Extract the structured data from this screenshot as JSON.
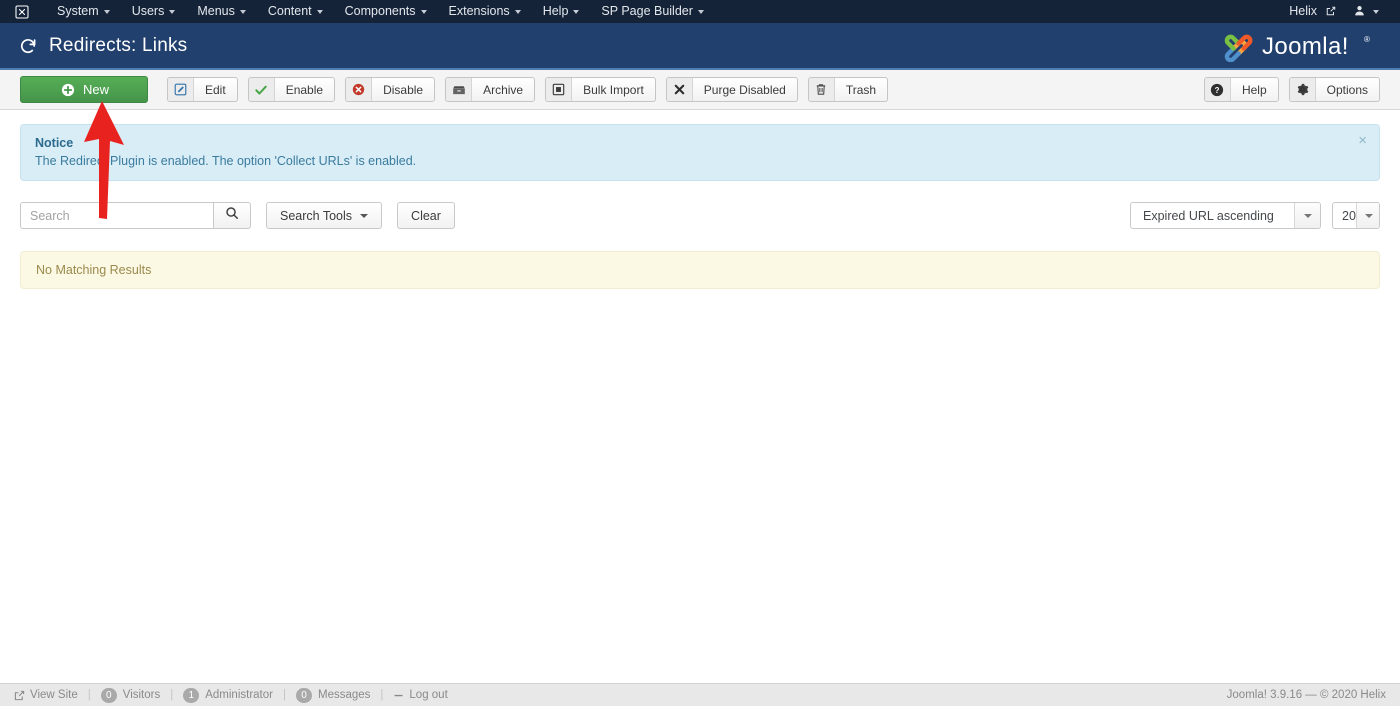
{
  "topnav": {
    "brand_icon": "joomla-mark-icon",
    "items": [
      {
        "label": "System",
        "has_caret": true
      },
      {
        "label": "Users",
        "has_caret": true
      },
      {
        "label": "Menus",
        "has_caret": true
      },
      {
        "label": "Content",
        "has_caret": true
      },
      {
        "label": "Components",
        "has_caret": true
      },
      {
        "label": "Extensions",
        "has_caret": true
      },
      {
        "label": "Help",
        "has_caret": true
      },
      {
        "label": "SP Page Builder",
        "has_caret": true
      }
    ],
    "site_link": "Helix",
    "site_link_icon": "external-link-icon",
    "user_icon": "user-icon"
  },
  "header": {
    "title": "Redirects: Links",
    "title_icon": "redirect-arrow-icon",
    "logo_text": "Joomla!",
    "logo_icon": "joomla-logo-icon",
    "bg_color": "#21406e",
    "accent_color": "#4d7db3"
  },
  "toolbar": {
    "new_label": "New",
    "new_icon": "plus-circle-icon",
    "new_color": "#48a14c",
    "buttons": [
      {
        "label": "Edit",
        "icon": "pencil-square-icon"
      },
      {
        "label": "Enable",
        "icon": "check-icon"
      },
      {
        "label": "Disable",
        "icon": "times-circle-icon"
      },
      {
        "label": "Archive",
        "icon": "archive-box-icon"
      },
      {
        "label": "Bulk Import",
        "icon": "import-square-icon"
      },
      {
        "label": "Purge Disabled",
        "icon": "x-mark-icon"
      },
      {
        "label": "Trash",
        "icon": "trash-icon"
      }
    ],
    "right_buttons": [
      {
        "label": "Help",
        "icon": "question-circle-icon"
      },
      {
        "label": "Options",
        "icon": "gear-icon"
      }
    ]
  },
  "notice": {
    "title": "Notice",
    "message": "The Redirect Plugin is enabled. The option 'Collect URLs' is enabled.",
    "close_icon": "close-icon",
    "bg_color": "#d9edf7",
    "text_color": "#3a7b9e"
  },
  "filters": {
    "search_placeholder": "Search",
    "search_value": "",
    "search_icon": "search-icon",
    "search_tools_label": "Search Tools",
    "clear_label": "Clear",
    "sort_value": "Expired URL ascending",
    "limit_value": "20"
  },
  "results": {
    "empty_message": "No Matching Results",
    "bg_color": "#fbf8e3",
    "text_color": "#9b8a4e"
  },
  "footer": {
    "view_site_label": "View Site",
    "view_site_icon": "external-link-icon",
    "visitors_count": "0",
    "visitors_label": "Visitors",
    "administrator_count": "1",
    "administrator_label": "Administrator",
    "messages_count": "0",
    "messages_label": "Messages",
    "logout_label": "Log out",
    "logout_icon": "minus-icon",
    "version_text": "Joomla! 3.9.16  —  © 2020 Helix"
  },
  "annotation": {
    "arrow_color": "#e8231f",
    "points_to": "new-button"
  }
}
